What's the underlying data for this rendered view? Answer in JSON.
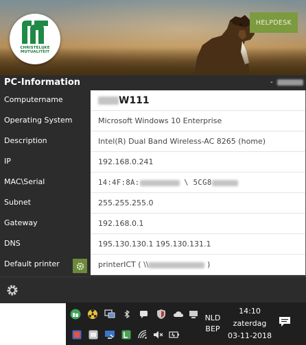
{
  "banner": {
    "logo_text": "CHRISTELIJKE MUTUALITEIT",
    "helpdesk_label": "HELPDESK"
  },
  "header": {
    "title": "PC-Information",
    "user_prefix": "-"
  },
  "rows": [
    {
      "label": "Computername",
      "value_visible": "W111"
    },
    {
      "label": "Operating System",
      "value": "Microsoft Windows 10 Enterprise"
    },
    {
      "label": "Description",
      "value": "Intel(R) Dual Band Wireless-AC 8265 (home)"
    },
    {
      "label": "IP",
      "value": "192.168.0.241"
    },
    {
      "label": "MAC\\Serial",
      "value_prefix": "14:4F:8A:",
      "value_mid": " \\ 5CG8"
    },
    {
      "label": "Subnet",
      "value": "255.255.255.0"
    },
    {
      "label": "Gateway",
      "value": "192.168.0.1"
    },
    {
      "label": "DNS",
      "value": "195.130.130.1 195.130.131.1"
    },
    {
      "label": "Default printer",
      "value_prefix": "printerICT ( \\\\",
      "value_suffix": " )"
    }
  ],
  "taskbar": {
    "language": "NLD",
    "keyboard": "BEP",
    "time": "14:10",
    "day": "zaterdag",
    "date": "03-11-2018"
  },
  "colors": {
    "accent_green": "#7c9a3e",
    "panel_dark": "#2c2c2c",
    "taskbar": "#1f1f1f"
  }
}
